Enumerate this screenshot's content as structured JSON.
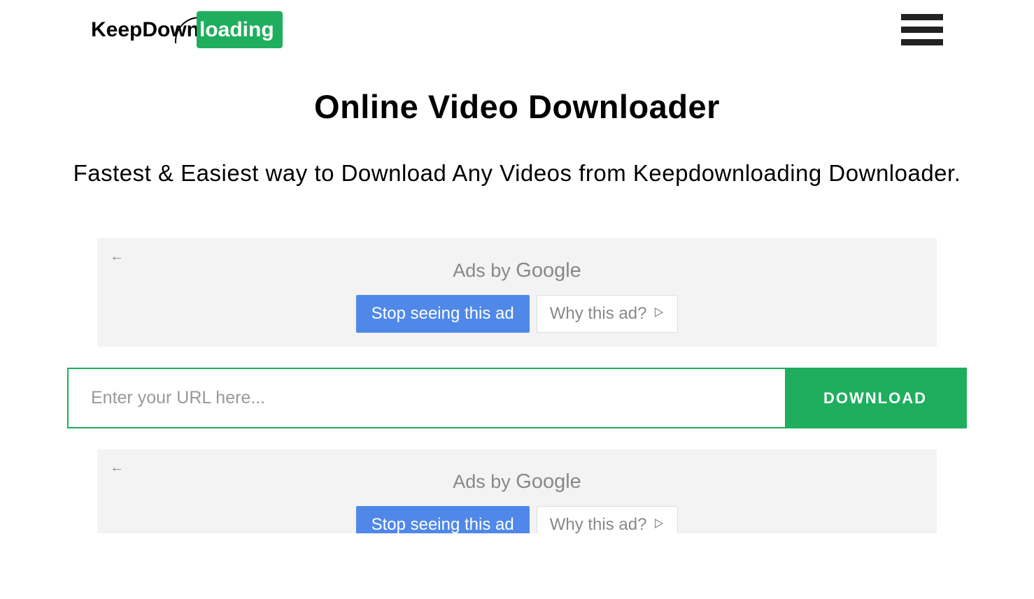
{
  "logo": {
    "part1": "Keep",
    "part2": "Down",
    "part3": "loading"
  },
  "hero": {
    "title": "Online Video Downloader",
    "subtitle": "Fastest & Easiest way to Download Any Videos from Keepdownloading Downloader."
  },
  "ad": {
    "back_arrow": "←",
    "label_prefix": "Ads by ",
    "label_brand": "Google",
    "stop_button": "Stop seeing this ad",
    "why_button": "Why this ad?"
  },
  "form": {
    "placeholder": "Enter your URL here...",
    "button": "DOWNLOAD"
  }
}
